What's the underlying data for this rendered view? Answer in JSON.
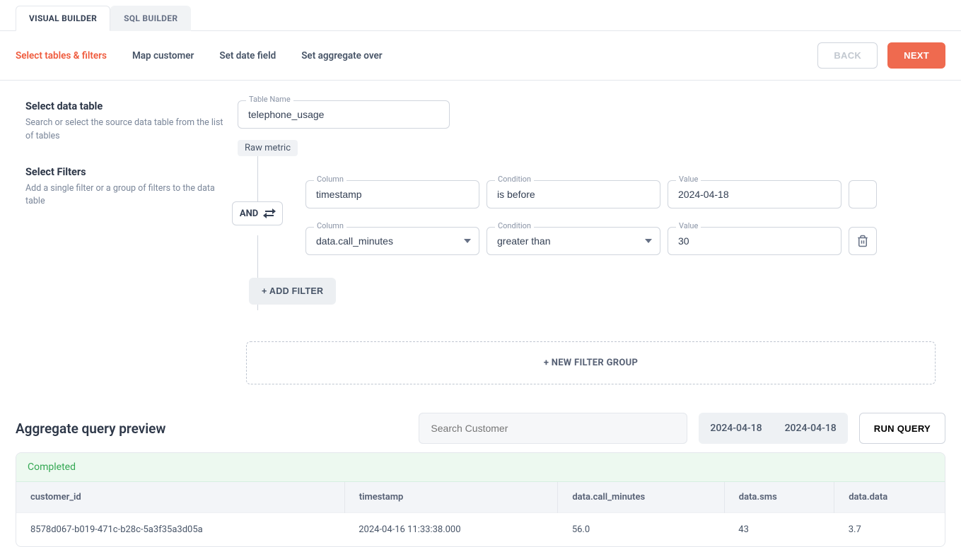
{
  "tabs": {
    "visual": "VISUAL BUILDER",
    "sql": "SQL BUILDER"
  },
  "steps": {
    "select": "Select tables & filters",
    "map": "Map customer",
    "date": "Set date field",
    "agg": "Set aggregate over"
  },
  "nav": {
    "back": "BACK",
    "next": "NEXT"
  },
  "left": {
    "dt_title": "Select data table",
    "dt_desc": "Search or select the source data table from the list of tables",
    "f_title": "Select Filters",
    "f_desc": "Add a single filter or a group of filters to the data table"
  },
  "table_name": {
    "label": "Table Name",
    "value": "telephone_usage"
  },
  "raw_metric": "Raw metric",
  "logic": "AND",
  "filters": [
    {
      "column_label": "Column",
      "column_value": "timestamp",
      "column_caret": false,
      "condition_label": "Condition",
      "condition_value": "is before",
      "condition_caret": false,
      "value_label": "Value",
      "value_value": "2024-04-18",
      "trash": false,
      "blank_box": true
    },
    {
      "column_label": "Column",
      "column_value": "data.call_minutes",
      "column_caret": true,
      "condition_label": "Condition",
      "condition_value": "greater than",
      "condition_caret": true,
      "value_label": "Value",
      "value_value": "30",
      "trash": true,
      "blank_box": false
    }
  ],
  "add_filter": "+ ADD FILTER",
  "new_filter_group": "+ NEW FILTER GROUP",
  "preview": {
    "title": "Aggregate query preview",
    "search_placeholder": "Search Customer",
    "date_from": "2024-04-18",
    "date_to": "2024-04-18",
    "run": "RUN QUERY",
    "status": "Completed",
    "columns": [
      "customer_id",
      "timestamp",
      "data.call_minutes",
      "data.sms",
      "data.data"
    ],
    "rows": [
      [
        "8578d067-b019-471c-b28c-5a3f35a3d05a",
        "2024-04-16 11:33:38.000",
        "56.0",
        "43",
        "3.7"
      ]
    ]
  }
}
